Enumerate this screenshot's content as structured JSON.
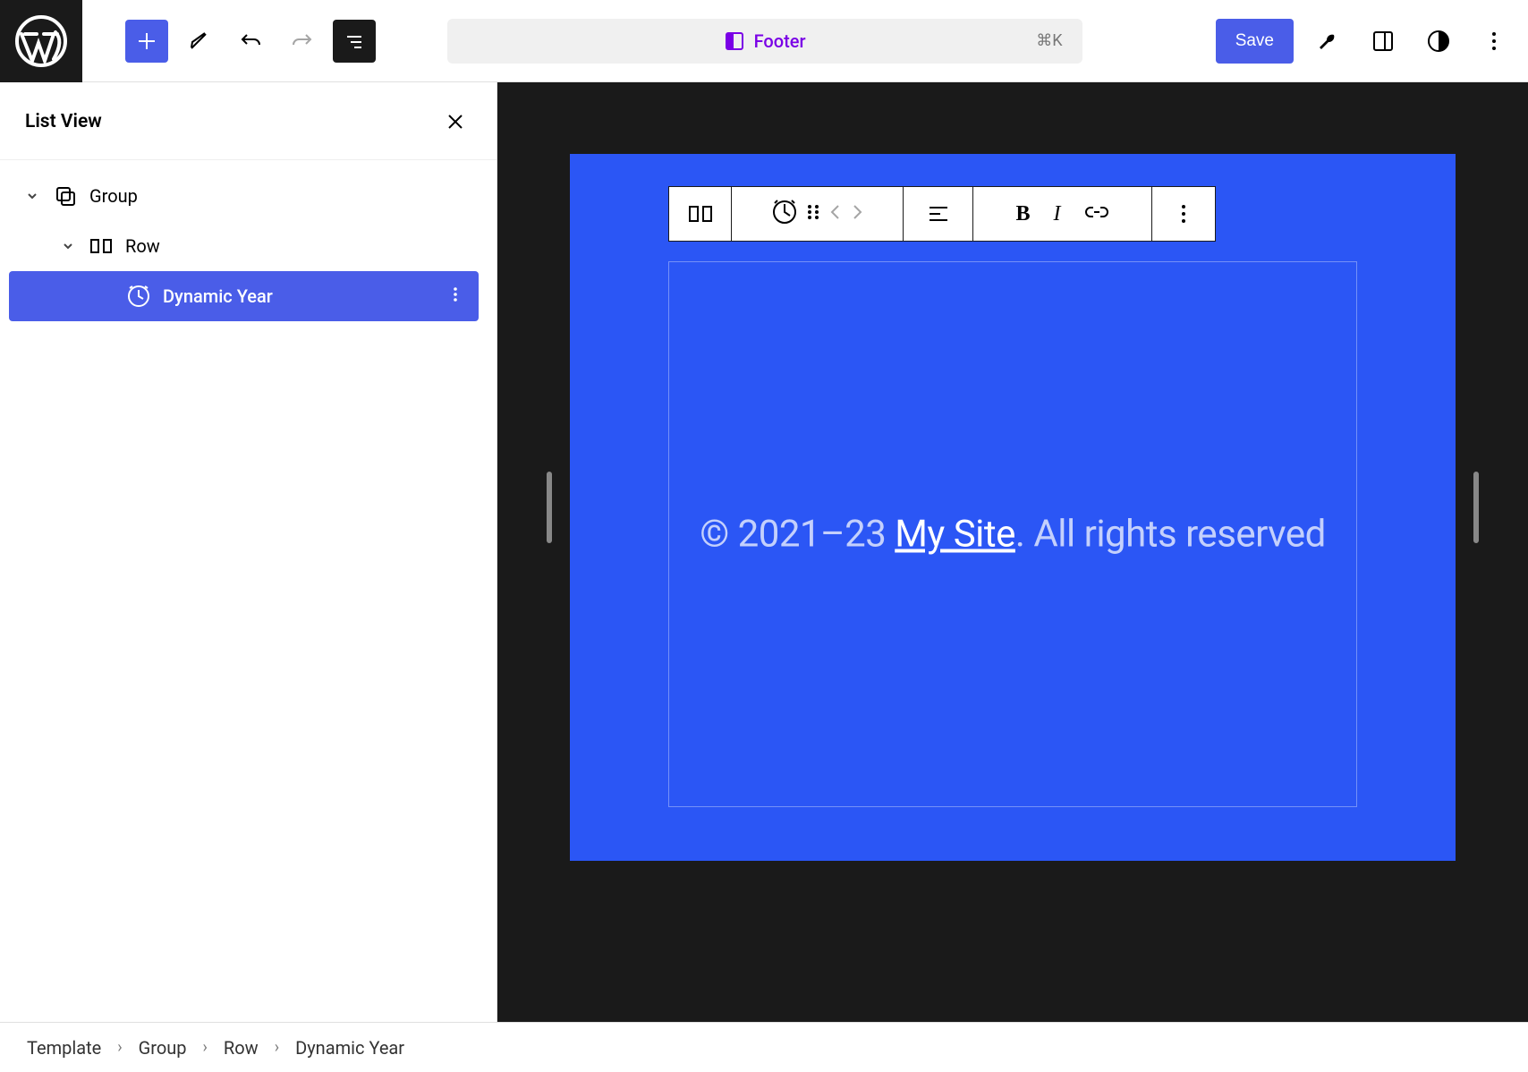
{
  "topbar": {
    "center_label": "Footer",
    "shortcut": "⌘K",
    "save_label": "Save"
  },
  "sidebar": {
    "title": "List View",
    "items": [
      {
        "label": "Group",
        "level": 0,
        "expanded": true,
        "icon": "group"
      },
      {
        "label": "Row",
        "level": 1,
        "expanded": true,
        "icon": "row"
      },
      {
        "label": "Dynamic Year",
        "level": 2,
        "selected": true,
        "icon": "dynamic-year"
      }
    ]
  },
  "canvas": {
    "footer_text_prefix": "© 2021–23 ",
    "footer_link_text": "My Site",
    "footer_text_suffix": ". All rights reserved"
  },
  "breadcrumb": [
    "Template",
    "Group",
    "Row",
    "Dynamic Year"
  ]
}
